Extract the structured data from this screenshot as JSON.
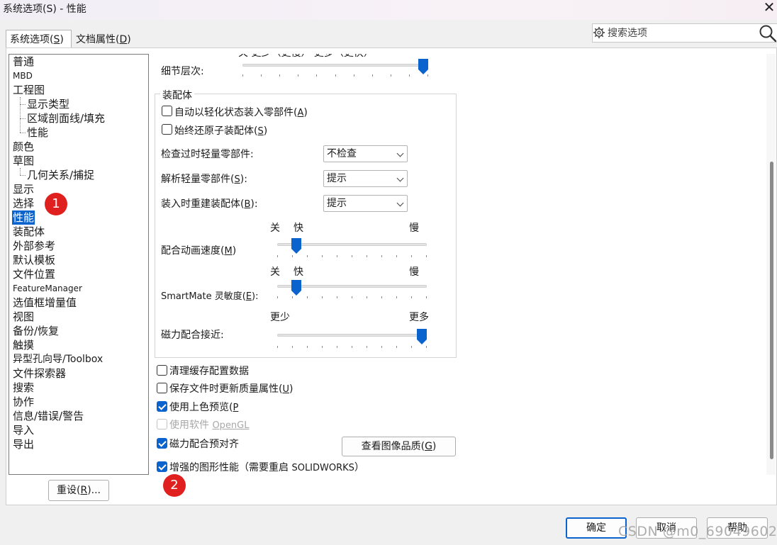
{
  "window": {
    "title": "系统选项(S) - 性能",
    "close_glyph": "✕"
  },
  "tabs": {
    "system_label": "系统选项",
    "system_key": "S",
    "doc_label": "文档属性",
    "doc_key": "D"
  },
  "search": {
    "placeholder": "搜索选项"
  },
  "tree": {
    "items": [
      "普通",
      "MBD",
      "工程图",
      "显示类型",
      "区域剖面线/填充",
      "性能",
      "颜色",
      "草图",
      "几何关系/捕捉",
      "显示",
      "选择",
      "性能",
      "装配体",
      "外部参考",
      "默认模板",
      "文件位置",
      "FeatureManager",
      "选值框增量值",
      "视图",
      "备份/恢复",
      "触摸",
      "异型孔向导/Toolbox",
      "文件探索器",
      "搜索",
      "协作",
      "信息/错误/警告",
      "导入",
      "导出"
    ]
  },
  "reset_button": {
    "label": "重设",
    "key": "R",
    "suffix": "..."
  },
  "badges": {
    "one": "1",
    "two": "2"
  },
  "detail": {
    "partial_top_text": "关  更少（更慢）            更多（更快）",
    "label": "细节层次:",
    "level": 1.0
  },
  "assembly": {
    "title": "装配体",
    "cb_lightweight": {
      "label": "自动以轻化状态装入零部件",
      "key": "A",
      "checked": false
    },
    "cb_restore": {
      "label": "始终还原子装配体",
      "key": "S",
      "checked": false
    },
    "check_outdated": {
      "label": "检查过时轻量零部件:",
      "value": "不检查"
    },
    "resolve_lightweight": {
      "label": "解析轻量零部件",
      "key": "S",
      "colon": ":",
      "value": "提示"
    },
    "rebuild_on_load": {
      "label": "装入时重建装配体",
      "key": "B",
      "colon": ":",
      "value": "提示"
    },
    "mate_anim": {
      "label": "配合动画速度",
      "key": "M",
      "off": "关",
      "fast": "快",
      "slow": "慢",
      "level": 0.1
    },
    "smartmate": {
      "label": "SmartMate 灵敏度",
      "key": "E",
      "colon": ":",
      "off": "关",
      "fast": "快",
      "slow": "慢",
      "level": 0.1
    },
    "magnetic": {
      "label": "磁力配合接近:",
      "less": "更少",
      "more": "更多",
      "level": 1.0
    }
  },
  "options": {
    "purge_cache": {
      "label": "清理缓存配置数据",
      "checked": false
    },
    "update_mass": {
      "label": "保存文件时更新质量属性",
      "key": "U",
      "checked": false
    },
    "shaded_preview": {
      "label": "使用上色预览",
      "key": "P",
      "checked": true
    },
    "software_opengl": {
      "label": "使用软件",
      "key_text": "OpenGL",
      "checked": false,
      "disabled": true
    },
    "magnetic_prealign": {
      "label": "磁力配合预对齐",
      "checked": true
    },
    "enhanced_graphics": {
      "label": "增强的图形性能（需要重启",
      "product": "SOLIDWORKS",
      "tail": "）",
      "checked": true
    }
  },
  "image_quality_button": {
    "label": "查看图像品质",
    "key": "G"
  },
  "footer": {
    "ok": "确定",
    "cancel": "取消",
    "help": "帮助"
  },
  "watermark": "CSDN @m0_69049602",
  "colors": {
    "accent": "#0b63ce",
    "badge": "#e0201e"
  }
}
